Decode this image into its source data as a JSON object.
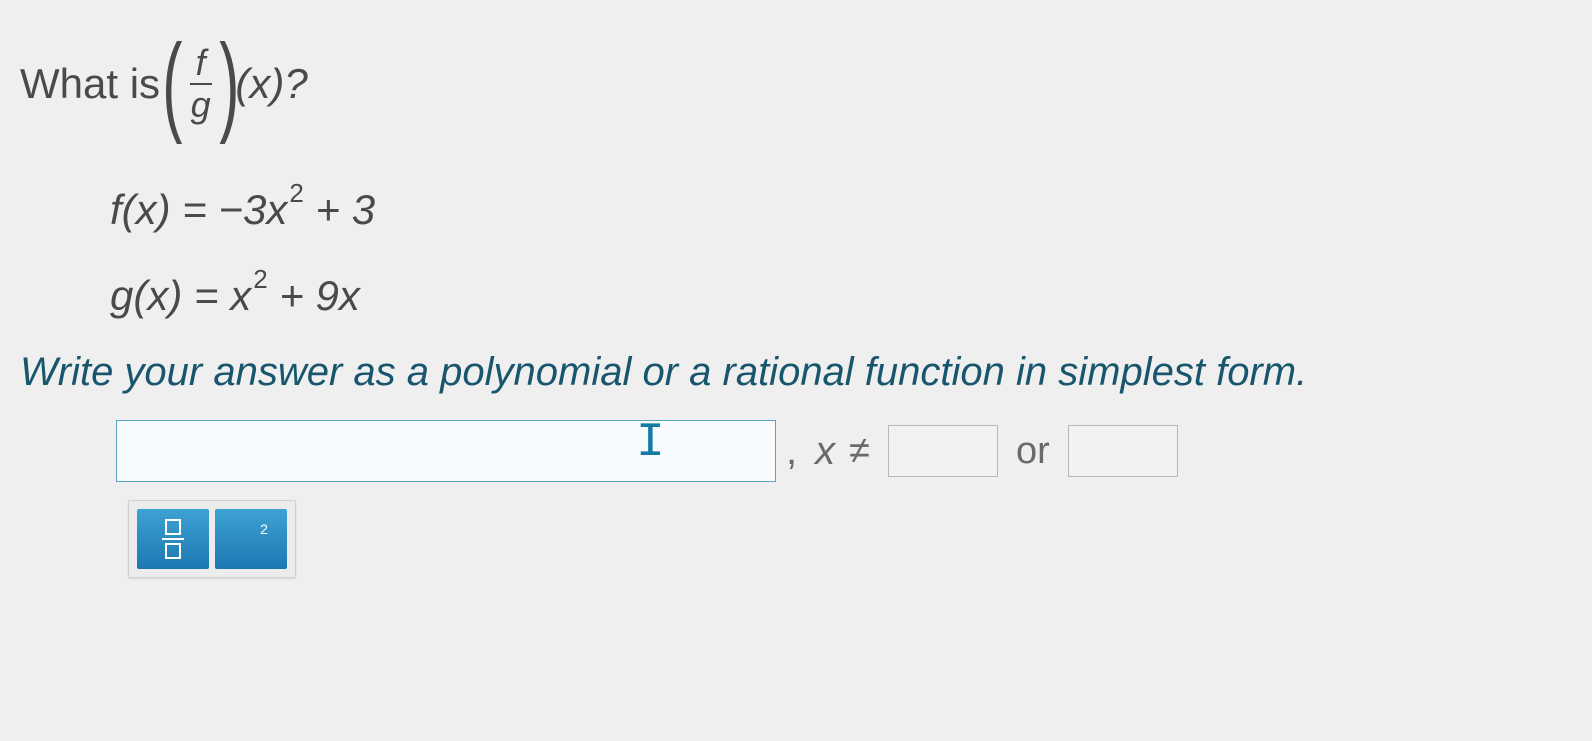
{
  "question": {
    "prefix": "What is",
    "frac_num": "f",
    "frac_den": "g",
    "suffix": "(x)?"
  },
  "functions": {
    "f": "f(x) = −3x",
    "f_exp": "2",
    "f_tail": " + 3",
    "g": "g(x) = x",
    "g_exp": "2",
    "g_tail": " + 9x"
  },
  "instruction": "Write your answer as a polynomial or a rational function in simplest form.",
  "answer": {
    "main_value": "",
    "cursor_glyph": "I",
    "comma": ",",
    "xvar": "x",
    "ne": "≠",
    "val1": "",
    "or": "or",
    "val2": ""
  },
  "toolbar": {
    "fraction_tip": "fraction",
    "exponent_label": "2"
  }
}
